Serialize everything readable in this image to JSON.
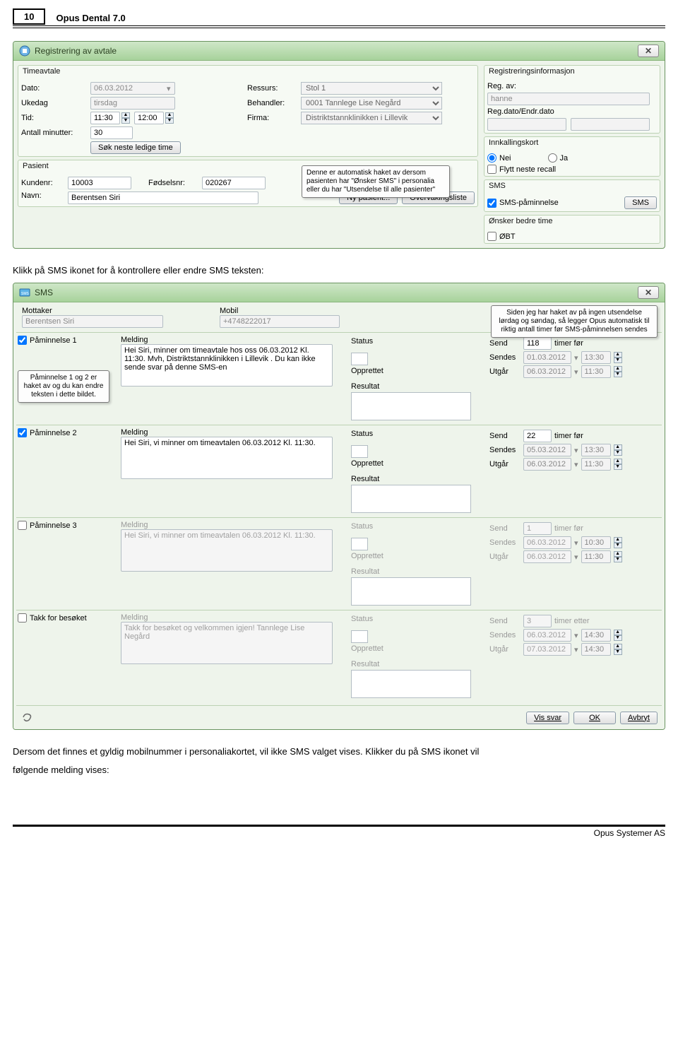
{
  "header": {
    "page_no": "10",
    "doc_title": "Opus Dental 7.0"
  },
  "footer": {
    "company": "Opus Systemer AS"
  },
  "text": {
    "line1": "Klikk på SMS ikonet for å kontrollere eller endre SMS teksten:",
    "line2a": "Dersom det finnes et gyldig mobilnummer i personaliakortet, vil ikke SMS valget vises. Klikker du på SMS ikonet vil",
    "line2b": "følgende melding vises:"
  },
  "win1": {
    "title": "Registrering av avtale",
    "sections": {
      "timeavtale": {
        "legend": "Timeavtale",
        "dato_lbl": "Dato:",
        "dato_val": "06.03.2012",
        "ukedag_lbl": "Ukedag",
        "ukedag_val": "tirsdag",
        "tid_lbl": "Tid:",
        "tid_from": "11:30",
        "tid_to": "12:00",
        "minutter_lbl": "Antall minutter:",
        "minutter_val": "30",
        "sokbtn": "Søk neste ledige time",
        "ressurs_lbl": "Ressurs:",
        "ressurs_val": "Stol 1",
        "behandler_lbl": "Behandler:",
        "behandler_val": "0001 Tannlege Lise Negård",
        "firma_lbl": "Firma:",
        "firma_val": "Distriktstannklinikken i Lillevik"
      },
      "pasient": {
        "legend": "Pasient",
        "kundenr_lbl": "Kundenr:",
        "kundenr_val": "10003",
        "fodselsnr_lbl": "Fødselsnr:",
        "fodselsnr_val": "020267",
        "navn_lbl": "Navn:",
        "navn_val": "Berentsen Siri",
        "nypasient_btn": "Ny pasient...",
        "overvak_btn": "Overvåkingsliste"
      },
      "reginfo": {
        "legend": "Registreringsinformasjon",
        "regav_lbl": "Reg. av:",
        "regav_val": "hanne",
        "regdato_lbl": "Reg.dato/Endr.dato"
      },
      "innkalling": {
        "legend": "Innkallingskort",
        "nei": "Nei",
        "ja": "Ja",
        "flytt": "Flytt neste recall"
      },
      "sms": {
        "legend": "SMS",
        "paminnelse": "SMS-påminnelse",
        "smsbtn": "SMS"
      },
      "onsker": {
        "legend": "Ønsker bedre time",
        "obt": "ØBT"
      }
    },
    "callout": "Denne er automatisk haket av dersom pasienten har \"Ønsker SMS\" i personalia eller du har \"Utsendelse til alle pasienter\""
  },
  "win2": {
    "title": "SMS",
    "mottaker_lbl": "Mottaker",
    "mottaker_val": "Berentsen Siri",
    "mobil_lbl": "Mobil",
    "mobil_val": "+4748222017",
    "callout_top": "Siden jeg har haket av på ingen utsendelse lørdag og søndag, så legger Opus automatisk til riktig antall timer før SMS-påminnelsen sendes",
    "callout_left": "Påminnelse 1 og 2 er haket av og du kan endre teksten i dette bildet.",
    "labels": {
      "melding": "Melding",
      "status": "Status",
      "opprettet": "Opprettet",
      "resultat": "Resultat",
      "send": "Send",
      "sendes": "Sendes",
      "utgar": "Utgår",
      "timerfor": "timer før",
      "timeretter": "timer etter"
    },
    "reminders": [
      {
        "check_lbl": "Påminnelse 1",
        "checked": true,
        "greyed": false,
        "msg": "Hei Siri, minner om timeavtale hos oss 06.03.2012 Kl. 11:30. Mvh, Distriktstannklinikken i Lillevik . Du kan ikke sende svar på denne SMS-en",
        "send_val": "118",
        "timer_after": false,
        "sendes_d": "01.03.2012",
        "sendes_t": "13:30",
        "utgar_d": "06.03.2012",
        "utgar_t": "11:30"
      },
      {
        "check_lbl": "Påminnelse 2",
        "checked": true,
        "greyed": false,
        "msg": "Hei Siri, vi minner om timeavtalen 06.03.2012 Kl. 11:30.",
        "send_val": "22",
        "timer_after": false,
        "sendes_d": "05.03.2012",
        "sendes_t": "13:30",
        "utgar_d": "06.03.2012",
        "utgar_t": "11:30"
      },
      {
        "check_lbl": "Påminnelse 3",
        "checked": false,
        "greyed": true,
        "msg": "Hei Siri, vi minner om timeavtalen 06.03.2012 Kl. 11:30.",
        "send_val": "1",
        "timer_after": false,
        "sendes_d": "06.03.2012",
        "sendes_t": "10:30",
        "utgar_d": "06.03.2012",
        "utgar_t": "11:30"
      },
      {
        "check_lbl": "Takk for besøket",
        "checked": false,
        "greyed": true,
        "msg": "Takk for besøket og velkommen igjen! Tannlege Lise Negård",
        "send_val": "3",
        "timer_after": true,
        "sendes_d": "06.03.2012",
        "sendes_t": "14:30",
        "utgar_d": "07.03.2012",
        "utgar_t": "14:30"
      }
    ],
    "bottom": {
      "vissvar": "Vis svar",
      "ok": "OK",
      "avbryt": "Avbryt"
    }
  },
  "icons": {
    "drop": "▾",
    "close": "✕"
  }
}
